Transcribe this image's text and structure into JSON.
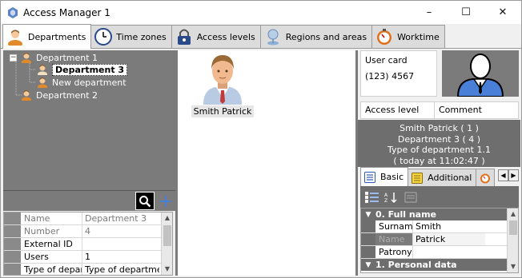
{
  "window": {
    "title": "Access Manager 1",
    "minimize": "–",
    "maximize": "☐",
    "close": "✕"
  },
  "tabs": [
    {
      "label": "Departments",
      "icon": "person-icon",
      "active": true
    },
    {
      "label": "Time zones",
      "icon": "clock-icon"
    },
    {
      "label": "Access levels",
      "icon": "padlock-icon"
    },
    {
      "label": "Regions and areas",
      "icon": "pin-icon"
    },
    {
      "label": "Worktime",
      "icon": "stopwatch-icon"
    }
  ],
  "tree": {
    "items": [
      {
        "label": "Department 1",
        "expander": "−"
      },
      {
        "label": "Department 3",
        "selected": true
      },
      {
        "label": "New department"
      },
      {
        "label": "Department 2"
      }
    ]
  },
  "properties": {
    "rows": [
      {
        "name": "Name",
        "value": "Department 3"
      },
      {
        "name": "Number",
        "value": "4"
      },
      {
        "name": "External ID",
        "value": ""
      },
      {
        "name": "Users",
        "value": "1"
      },
      {
        "name": "Type of department",
        "value": "Type of department"
      }
    ]
  },
  "employee": {
    "name": "Smith Patrick"
  },
  "user_card": {
    "label": "User card",
    "value": "(123) 4567"
  },
  "access_table": {
    "col1": "Access level",
    "col2": "Comment"
  },
  "info": {
    "line1": "Smith Patrick ( 1 )",
    "line2": "Department 3 ( 4 )",
    "line3": "Type of department 1.1",
    "line4": "( today at 11:02:47 )"
  },
  "right_tabs": [
    {
      "label": "Basic",
      "active": true
    },
    {
      "label": "Additional"
    }
  ],
  "grid": {
    "category1": "0. Full name",
    "rows": [
      {
        "name": "Surname",
        "value": "Smith"
      },
      {
        "name": "Name",
        "value": "Patrick"
      },
      {
        "name": "Patronymic",
        "value": ""
      }
    ],
    "category2": "1. Personal data"
  },
  "colors": {
    "panel_gray": "#7b7b7b",
    "accent_blue": "#4a7fd8"
  }
}
